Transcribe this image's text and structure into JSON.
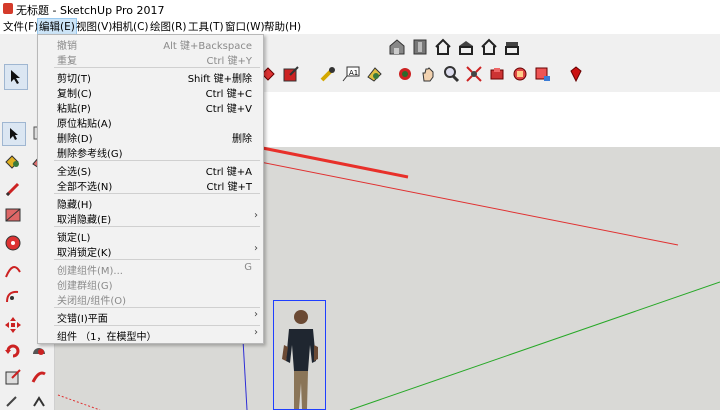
{
  "window": {
    "title": "无标题 - SketchUp Pro 2017"
  },
  "menubar": [
    {
      "id": "file",
      "label": "文件(F)"
    },
    {
      "id": "edit",
      "label": "编辑(E)"
    },
    {
      "id": "view",
      "label": "视图(V)"
    },
    {
      "id": "camera",
      "label": "相机(C)"
    },
    {
      "id": "draw",
      "label": "绘图(R)"
    },
    {
      "id": "tools",
      "label": "工具(T)"
    },
    {
      "id": "window",
      "label": "窗口(W)"
    },
    {
      "id": "help",
      "label": "帮助(H)"
    }
  ],
  "edit_menu": {
    "undo": {
      "label": "撤销",
      "shortcut": "Alt 键+Backspace"
    },
    "redo": {
      "label": "重复",
      "shortcut": "Ctrl 键+Y"
    },
    "cut": {
      "label": "剪切(T)",
      "shortcut": "Shift 键+删除"
    },
    "copy": {
      "label": "复制(C)",
      "shortcut": "Ctrl 键+C"
    },
    "paste": {
      "label": "粘贴(P)",
      "shortcut": "Ctrl 键+V"
    },
    "paste_in_place": {
      "label": "原位粘贴(A)"
    },
    "delete": {
      "label": "删除(D)",
      "shortcut": "删除"
    },
    "delete_guides": {
      "label": "删除参考线(G)"
    },
    "select_all": {
      "label": "全选(S)",
      "shortcut": "Ctrl 键+A"
    },
    "select_none": {
      "label": "全部不选(N)",
      "shortcut": "Ctrl 键+T"
    },
    "hide": {
      "label": "隐藏(H)"
    },
    "unhide": {
      "label": "取消隐藏(E)",
      "arrow": "›"
    },
    "lock": {
      "label": "锁定(L)"
    },
    "unlock": {
      "label": "取消锁定(K)",
      "arrow": "›"
    },
    "make_component": {
      "label": "创建组件(M)...",
      "shortcut": "G"
    },
    "make_group": {
      "label": "创建群组(G)"
    },
    "close_group": {
      "label": "关闭组/组件(O)"
    },
    "intersect": {
      "label": "交错(I)平面",
      "arrow": "›"
    },
    "component": {
      "label": "组件 （1，在模型中）",
      "arrow": "›"
    }
  },
  "colors": {
    "menu_highlight": "#cce4f7",
    "annotation_arrow": "#e8302a",
    "axis_red": "#e03030",
    "axis_green": "#27a827",
    "axis_blue": "#2e2ed6",
    "ground": "#d9d9d6",
    "selection_box": "#1f3fff"
  },
  "toolbar_icons": [
    "iso-view-icon",
    "top-view-icon",
    "front-view-icon",
    "right-view-icon",
    "back-view-icon",
    "left-view-icon"
  ],
  "toolbar2_icons": [
    "paint-bucket-icon",
    "move-icon",
    "tape-measure-icon",
    "text-icon",
    "paint-icon",
    "orbit-icon",
    "pan-icon",
    "zoom-icon",
    "zoom-extents-icon",
    "warehouse-icon",
    "extension-icon",
    "share-icon",
    "ruby-icon"
  ],
  "text_tool_label": "A1"
}
